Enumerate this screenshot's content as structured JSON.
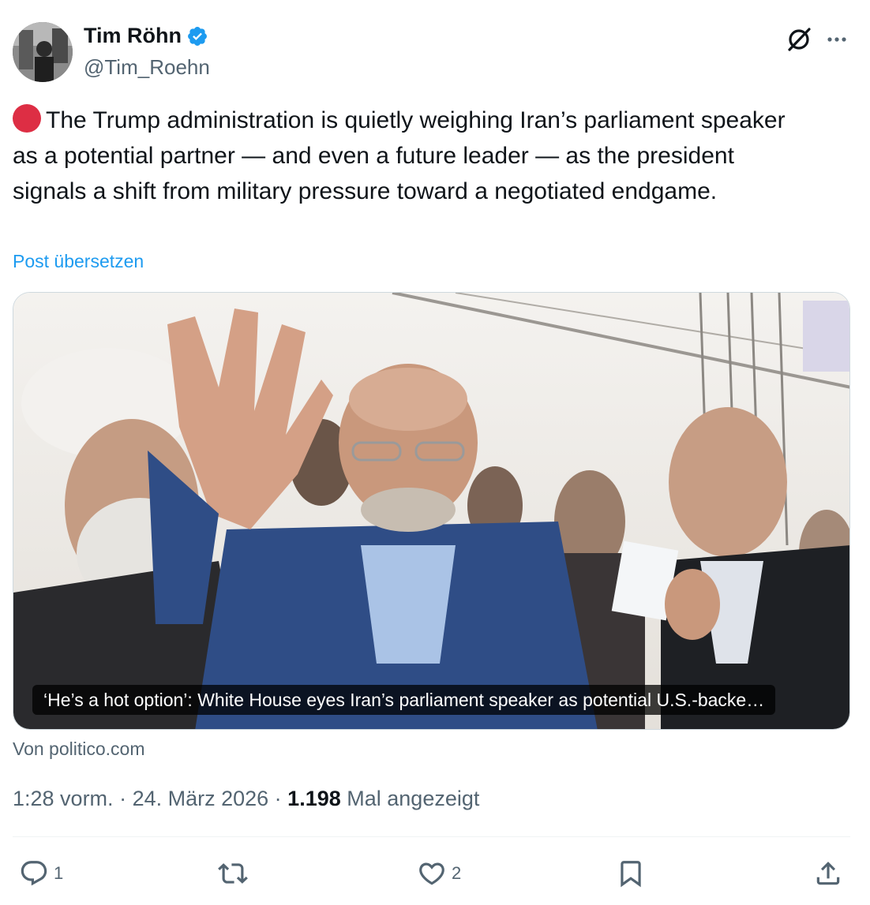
{
  "author": {
    "display_name": "Tim Röhn",
    "handle": "@Tim_Roehn",
    "verified": true
  },
  "icons": {
    "verified": "verified-badge-icon",
    "grok": "grok-icon",
    "more": "more-icon",
    "reply": "reply-icon",
    "repost": "repost-icon",
    "like": "heart-icon",
    "bookmark": "bookmark-icon",
    "share": "share-icon"
  },
  "tweet": {
    "emoji": "red-circle",
    "text": "The Trump administration is quietly weighing Iran’s parliament speaker as a potential partner — and even a future leader — as the president signals a shift from military pressure toward a negotiated endgame.",
    "translate_label": "Post übersetzen"
  },
  "card": {
    "caption": "‘He’s a hot option’: White House eyes Iran’s parliament speaker as potential U.S.-backe…",
    "source": "Von politico.com"
  },
  "meta": {
    "time": "1:28 vorm.",
    "separator": " · ",
    "date": "24. März 2026",
    "views_count": "1.198",
    "views_label": "Mal angezeigt"
  },
  "actions": {
    "replies": "1",
    "reposts": "",
    "likes": "2"
  },
  "colors": {
    "link": "#1d9bf0",
    "verified": "#1d9bf0",
    "secondary_text": "#536471",
    "primary_text": "#0f1419",
    "red_dot": "#dd2e44"
  }
}
